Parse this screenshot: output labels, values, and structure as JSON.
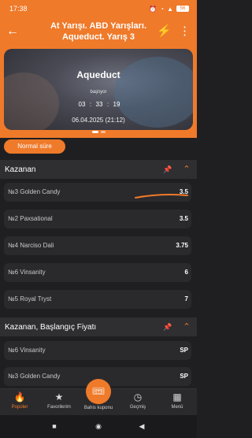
{
  "status_bar": {
    "time": "17:38",
    "icons": [
      "sim-icon",
      "alarm-icon",
      "wifi-icon",
      "signal-icon"
    ],
    "battery": "56"
  },
  "header": {
    "back_icon": "arrow-left-icon",
    "title": "At Yarışı. ABD Yarışları. Aqueduct. Yarış 3",
    "bolt_icon": "lightning-icon",
    "more_icon": "more-vertical-icon"
  },
  "banner": {
    "venue": "Aqueduct",
    "starts_label": "başlıyor",
    "countdown": {
      "h": "03",
      "m": "33",
      "s": "19"
    },
    "date": "06.04.2025 (21:12)"
  },
  "filter_chip": "Normal süre",
  "sections": [
    {
      "title": "Kazanan",
      "rows": [
        {
          "runner": "№3 Golden Candy",
          "odds": "3.5"
        },
        {
          "runner": "№2 Paxsational",
          "odds": "3.5"
        },
        {
          "runner": "№4 Narciso Dali",
          "odds": "3.75"
        },
        {
          "runner": "№6 Vinsanity",
          "odds": "6"
        },
        {
          "runner": "№5 Royal Tryst",
          "odds": "7"
        }
      ]
    },
    {
      "title": "Kazanan, Başlangıç Fiyatı",
      "rows": [
        {
          "runner": "№6 Vinsanity",
          "odds": "SP"
        },
        {
          "runner": "№3 Golden Candy",
          "odds": "SP"
        }
      ]
    }
  ],
  "bottom_nav": {
    "items": [
      {
        "label": "Popüler",
        "icon": "fire-icon",
        "active": true
      },
      {
        "label": "Favorilerim",
        "icon": "star-icon",
        "active": false
      },
      {
        "label": "Bahis kuponu",
        "icon": "ticket-icon",
        "active": false
      },
      {
        "label": "Geçmiş",
        "icon": "clock-icon",
        "active": false
      },
      {
        "label": "Menü",
        "icon": "grid-icon",
        "active": false
      }
    ]
  },
  "colors": {
    "accent": "#ef7a2a",
    "background": "#1f1f21",
    "row": "#2a2a2d"
  }
}
